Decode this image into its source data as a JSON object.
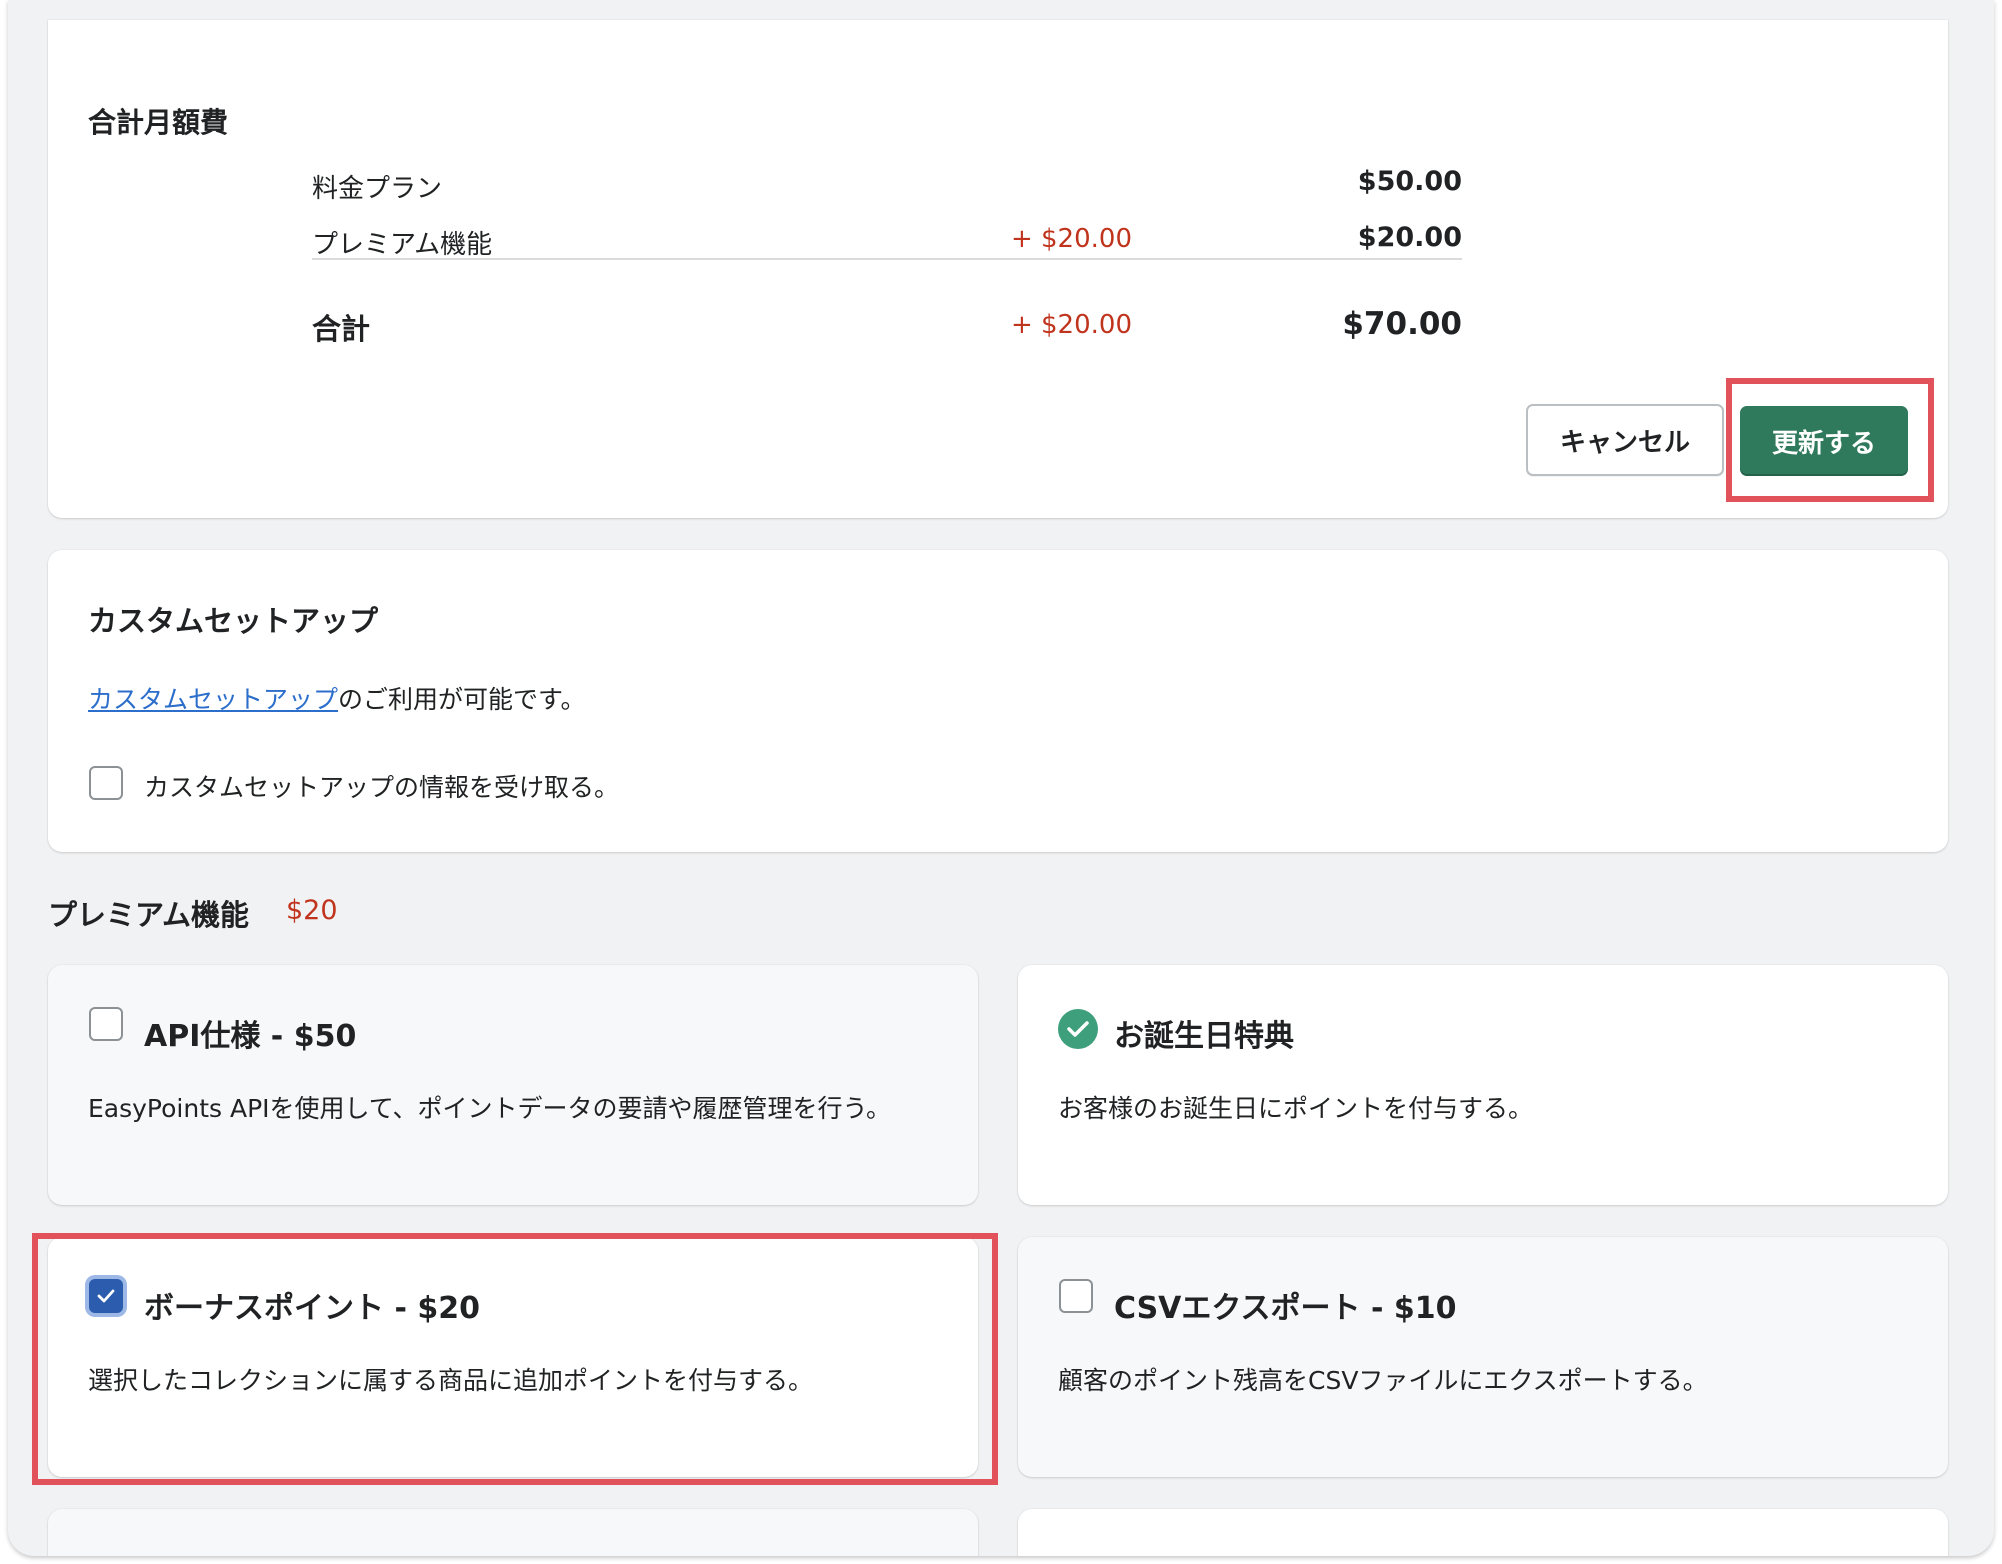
{
  "summary": {
    "title": "合計月額費",
    "rows": [
      {
        "label": "料金プラン",
        "change": "",
        "amount": "$50.00"
      },
      {
        "label": "プレミアム機能",
        "change": "+ $20.00",
        "amount": "$20.00"
      }
    ],
    "total": {
      "label": "合計",
      "change": "+ $20.00",
      "amount": "$70.00"
    },
    "cancel_label": "キャンセル",
    "update_label": "更新する"
  },
  "custom_setup": {
    "title": "カスタムセットアップ",
    "link_text": "カスタムセットアップ",
    "link_suffix": "のご利用が可能です。",
    "checkbox_label": "カスタムセットアップの情報を受け取る。",
    "checkbox_checked": false
  },
  "premium": {
    "heading": "プレミアム機能",
    "price": "$20",
    "features": [
      {
        "title": "API仕様 - $50",
        "description": "EasyPoints APIを使用して、ポイントデータの要請や履歴管理を行う。",
        "state": "unchecked"
      },
      {
        "title": "お誕生日特典",
        "description": "お客様のお誕生日にポイントを付与する。",
        "state": "included"
      },
      {
        "title": "ボーナスポイント - $20",
        "description": "選択したコレクションに属する商品に追加ポイントを付与する。",
        "state": "checked"
      },
      {
        "title": "CSVエクスポート - $10",
        "description": "顧客のポイント残高をCSVファイルにエクスポートする。",
        "state": "unchecked"
      }
    ]
  },
  "colors": {
    "accent_green": "#2f7a5c",
    "price_red": "#c0341d",
    "highlight_red": "#e2525a",
    "link_blue": "#2c6ecb",
    "checkbox_blue": "#2c5cad",
    "included_green": "#3d9f7b"
  }
}
